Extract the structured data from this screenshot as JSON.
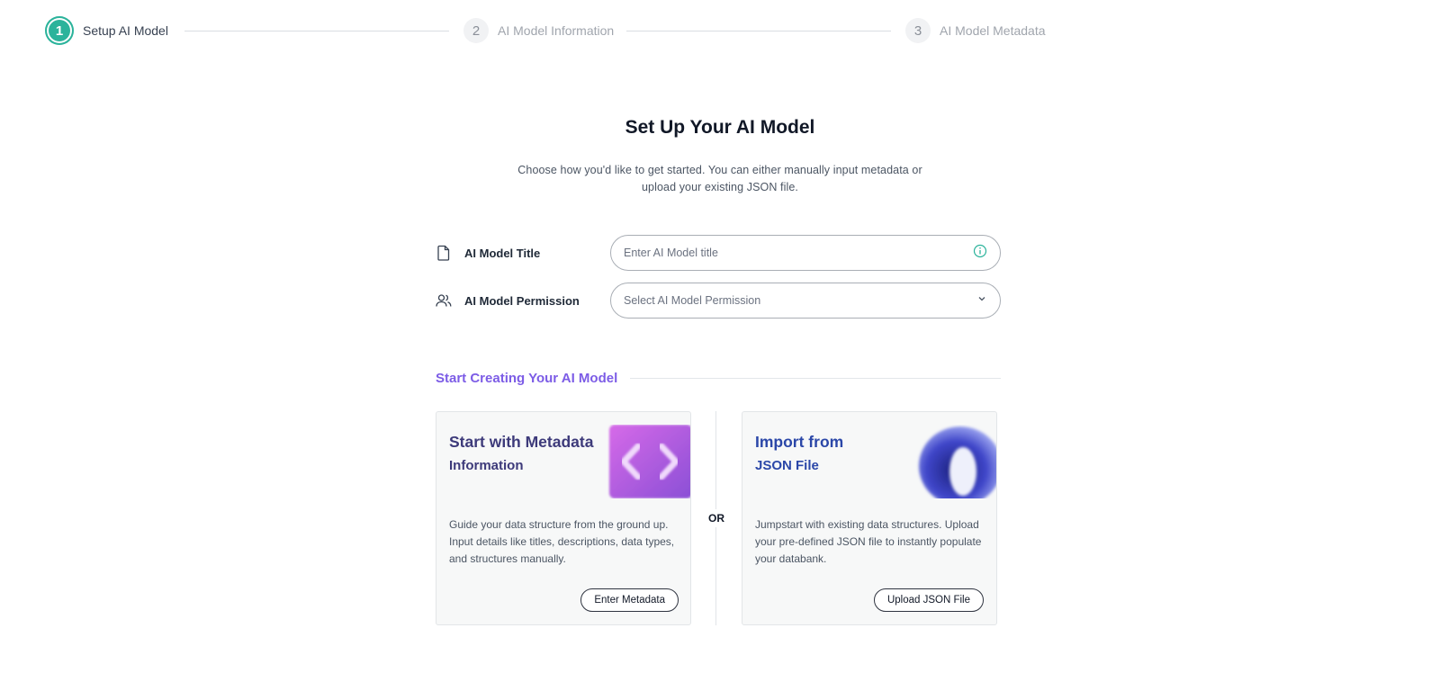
{
  "stepper": {
    "steps": [
      {
        "number": "1",
        "label": "Setup AI Model",
        "state": "active"
      },
      {
        "number": "2",
        "label": "AI Model Information",
        "state": "inactive"
      },
      {
        "number": "3",
        "label": "AI Model Metadata",
        "state": "inactive"
      }
    ]
  },
  "header": {
    "title": "Set Up Your AI Model",
    "subtitle": "Choose how you'd like to get started. You can either manually input metadata or upload your existing JSON file."
  },
  "form": {
    "title_field": {
      "label": "AI Model Title",
      "placeholder": "Enter AI Model title",
      "icon": "document-icon",
      "trailing_icon": "info-icon"
    },
    "permission_field": {
      "label": "AI Model Permission",
      "selected": "Select AI Model Permission",
      "icon": "users-icon",
      "trailing_icon": "chevron-down-icon"
    }
  },
  "section": {
    "heading": "Start Creating Your AI Model"
  },
  "cards": {
    "metadata": {
      "title_line1": "Start with Metadata",
      "title_line2": "Information",
      "description": "Guide your data structure from the ground up. Input details like titles, descriptions, data types, and structures manually.",
      "button": "Enter Metadata",
      "icon": "code-brackets-icon"
    },
    "or_label": "OR",
    "json": {
      "title_line1": "Import from",
      "title_line2": "JSON File",
      "description": "Jumpstart with existing data structures. Upload your pre-defined JSON file to instantly populate your databank.",
      "button": "Upload JSON File",
      "icon": "ring-3d-icon"
    }
  },
  "colors": {
    "accent_teal": "#2bb39b",
    "accent_purple": "#7c5ce6",
    "card_title_blue": "#2b47a8"
  }
}
